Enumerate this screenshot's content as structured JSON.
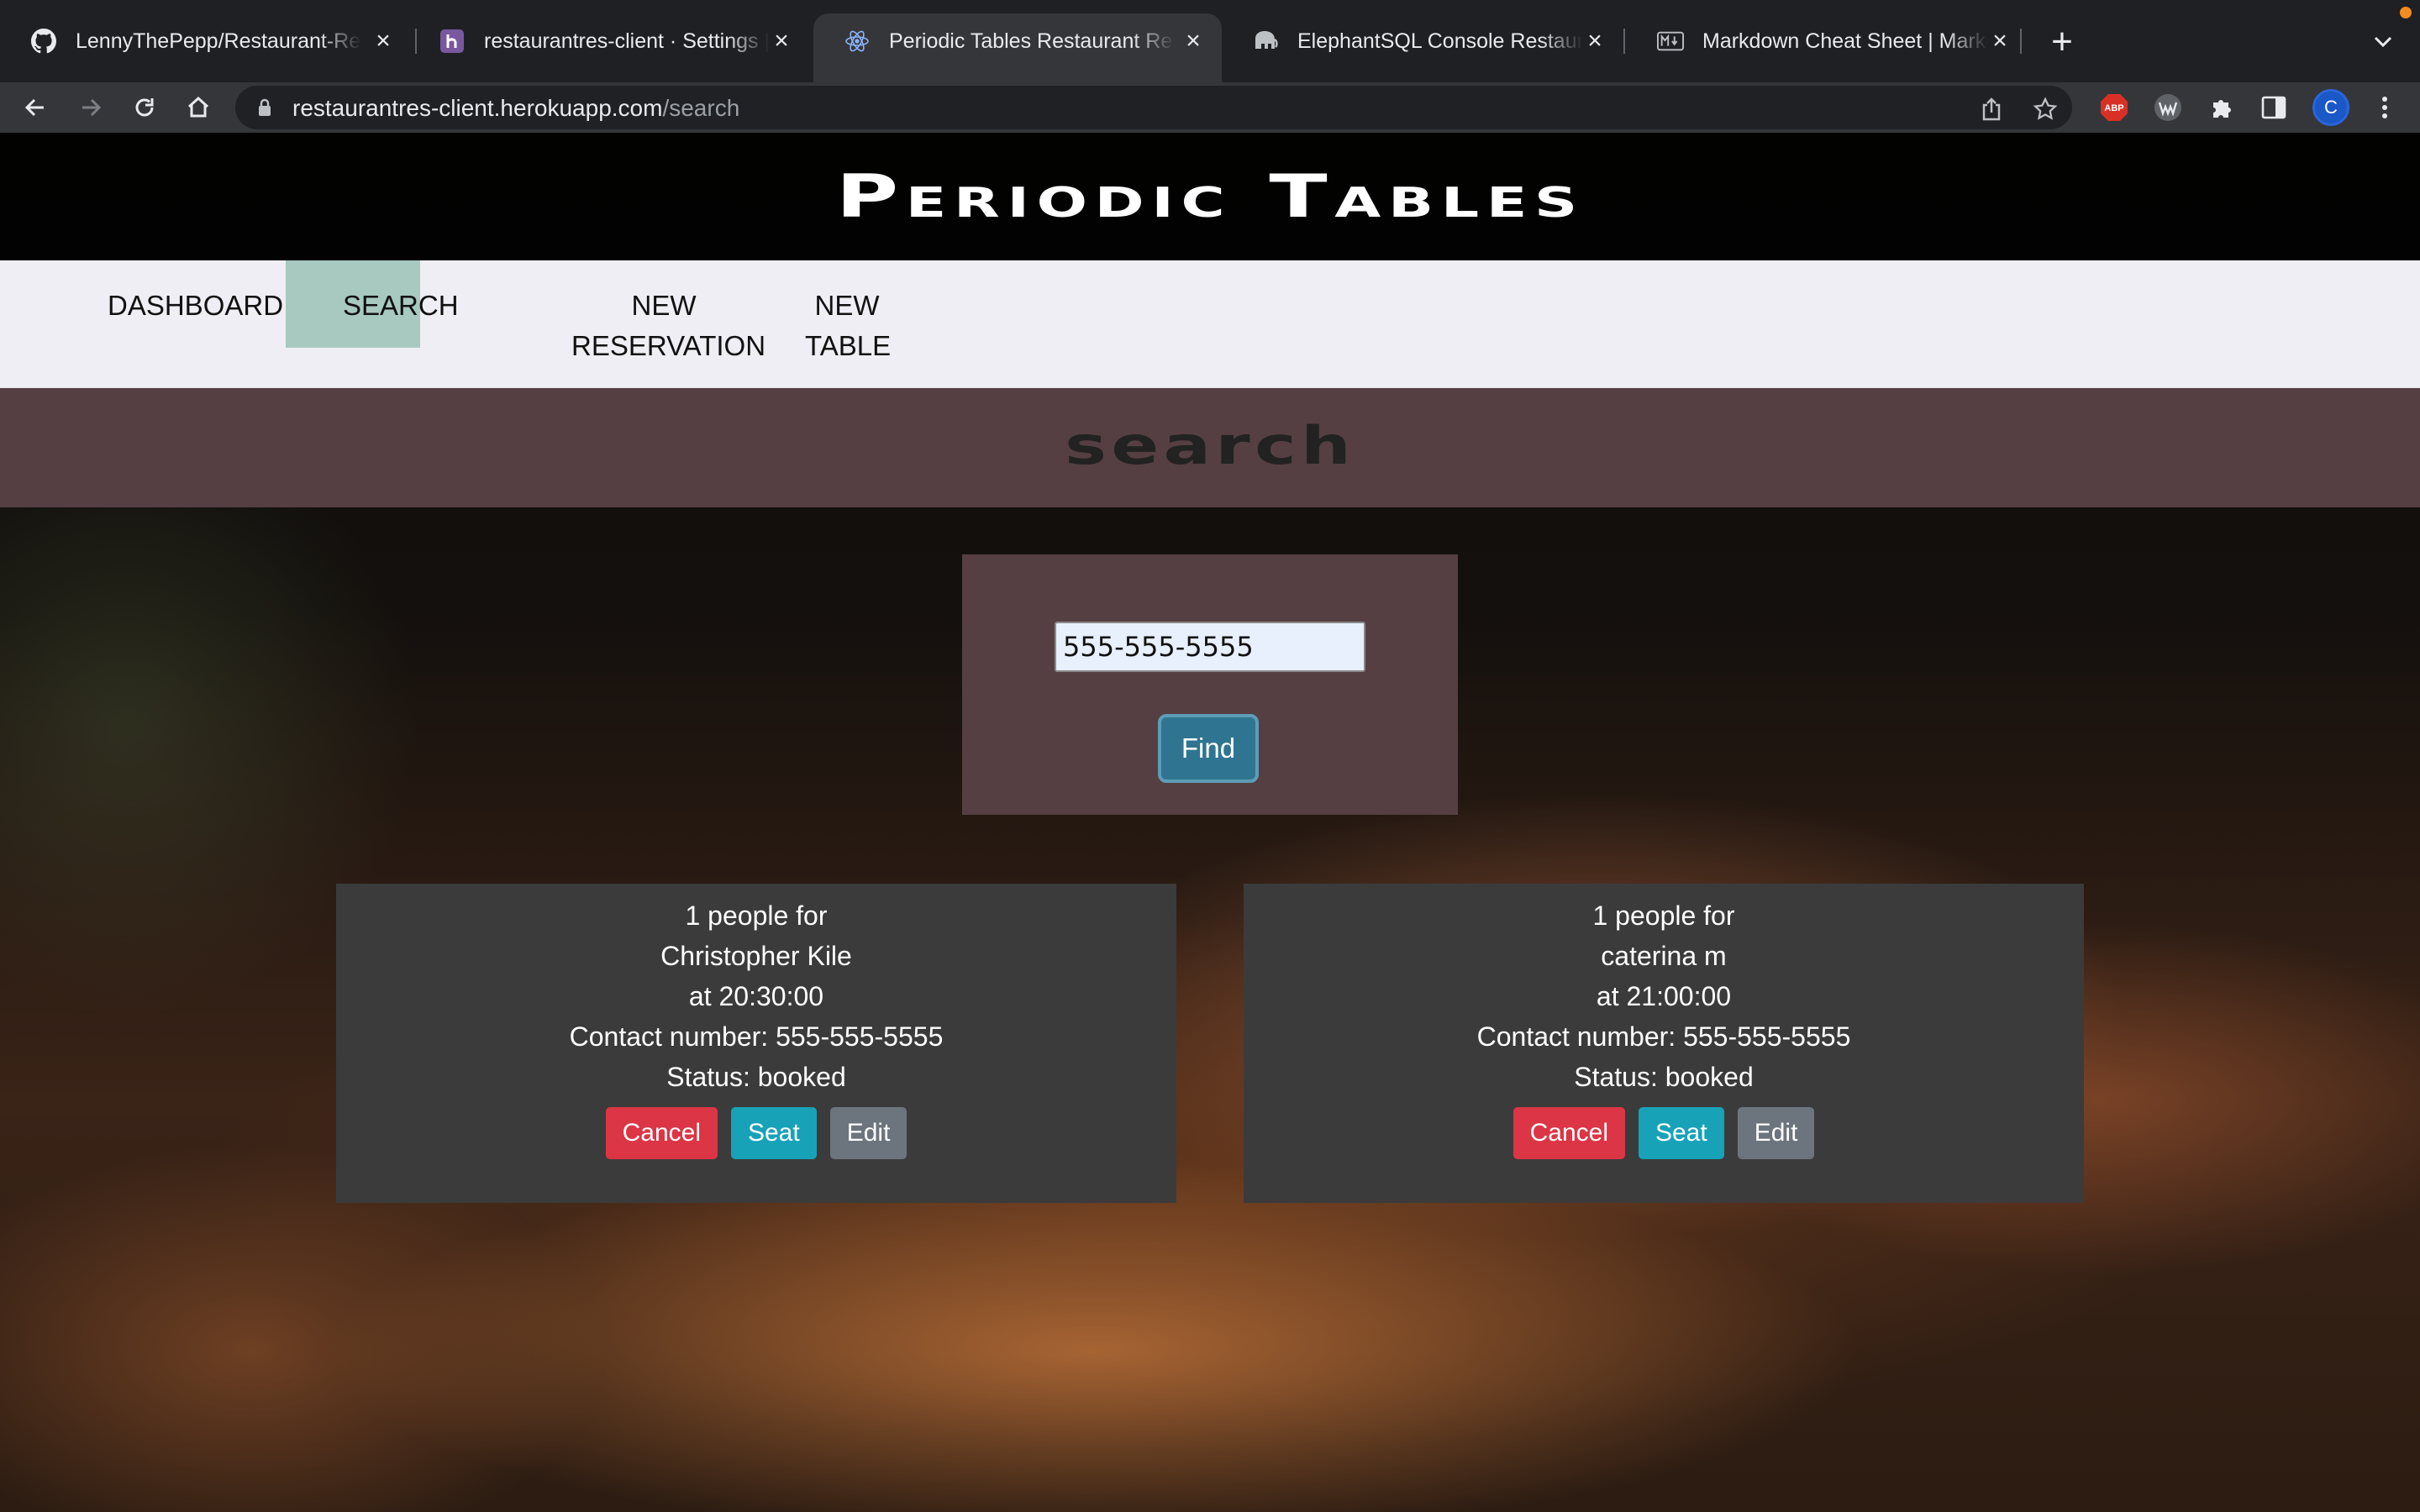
{
  "browser": {
    "tabs": [
      {
        "title": "LennyThePepp/Restaurant-Res",
        "icon": "github-icon",
        "active": false
      },
      {
        "title": "restaurantres-client · Settings |",
        "icon": "heroku-icon",
        "active": false
      },
      {
        "title": "Periodic Tables Restaurant Res",
        "icon": "react-icon",
        "active": true
      },
      {
        "title": "ElephantSQL Console Restaura",
        "icon": "elephant-icon",
        "active": false
      },
      {
        "title": "Markdown Cheat Sheet | Markd",
        "icon": "markdown-icon",
        "active": false
      }
    ],
    "url_host": "restaurantres-client.herokuapp.com",
    "url_path": "/search",
    "profile_initial": "C",
    "extension_abp": "ABP"
  },
  "app": {
    "title": "Periodic Tables",
    "nav": [
      "DASHBOARD",
      "SEARCH",
      "NEW RESERVATION",
      "NEW TABLE"
    ],
    "section_title": "search",
    "search": {
      "value": "555-555-5555",
      "button": "Find"
    },
    "reservations": [
      {
        "people_line": "1 people for",
        "name": "Christopher Kile",
        "time_line": "at 20:30:00",
        "contact_line": "Contact number: 555-555-5555",
        "status_line": "Status: booked",
        "cancel": "Cancel",
        "seat": "Seat",
        "edit": "Edit"
      },
      {
        "people_line": "1 people for",
        "name": "caterina m",
        "time_line": "at 21:00:00",
        "contact_line": "Contact number: 555-555-5555",
        "status_line": "Status: booked",
        "cancel": "Cancel",
        "seat": "Seat",
        "edit": "Edit"
      }
    ]
  },
  "colors": {
    "banner": "#000000",
    "nav_bg": "#eeeef4",
    "nav_active": "#a8c9bf",
    "section_bg": "#553f42",
    "card_bg": "#3b3b3b",
    "cancel": "#dc3545",
    "seat": "#17a2b8",
    "edit": "#6c757d",
    "find": "#2f7591"
  }
}
